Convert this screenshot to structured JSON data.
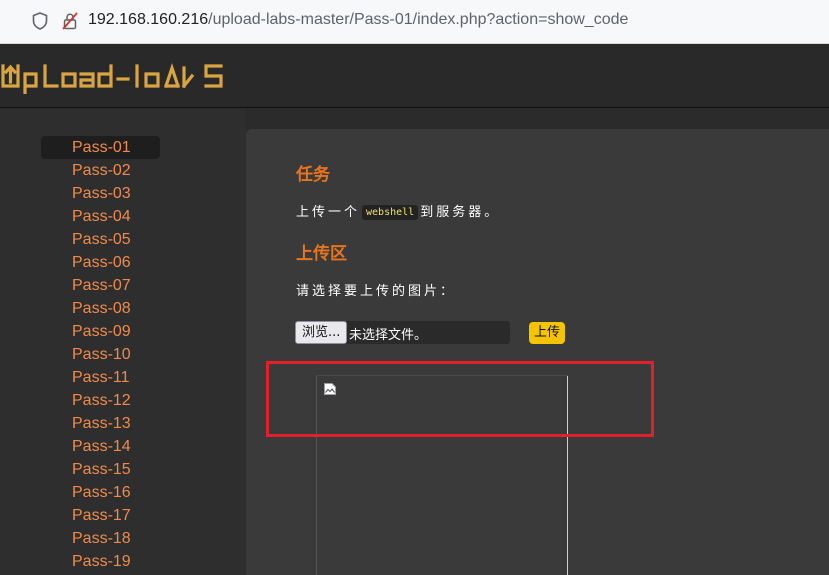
{
  "browser": {
    "url_host": "192.168.160.216",
    "url_path": "/upload-labs-master/Pass-01/index.php?action=show_code"
  },
  "header": {
    "logo_text": "UpLoad-labs"
  },
  "sidebar": {
    "active": "Pass-01",
    "items": [
      "Pass-01",
      "Pass-02",
      "Pass-03",
      "Pass-04",
      "Pass-05",
      "Pass-06",
      "Pass-07",
      "Pass-08",
      "Pass-09",
      "Pass-10",
      "Pass-11",
      "Pass-12",
      "Pass-13",
      "Pass-14",
      "Pass-15",
      "Pass-16",
      "Pass-17",
      "Pass-18",
      "Pass-19"
    ]
  },
  "main": {
    "task_title": "任务",
    "task_before": "上传一个",
    "task_code": "webshell",
    "task_after": "到服务器。",
    "upload_title": "上传区",
    "choose_label": "请选择要上传的图片：",
    "browse_label": "浏览...",
    "file_status": "未选择文件。",
    "upload_label": "上传"
  },
  "colors": {
    "accent_orange": "#e8741e",
    "nav_text": "#f08a4b",
    "upload_button": "#f5c400",
    "highlight_box": "#e0212b"
  }
}
